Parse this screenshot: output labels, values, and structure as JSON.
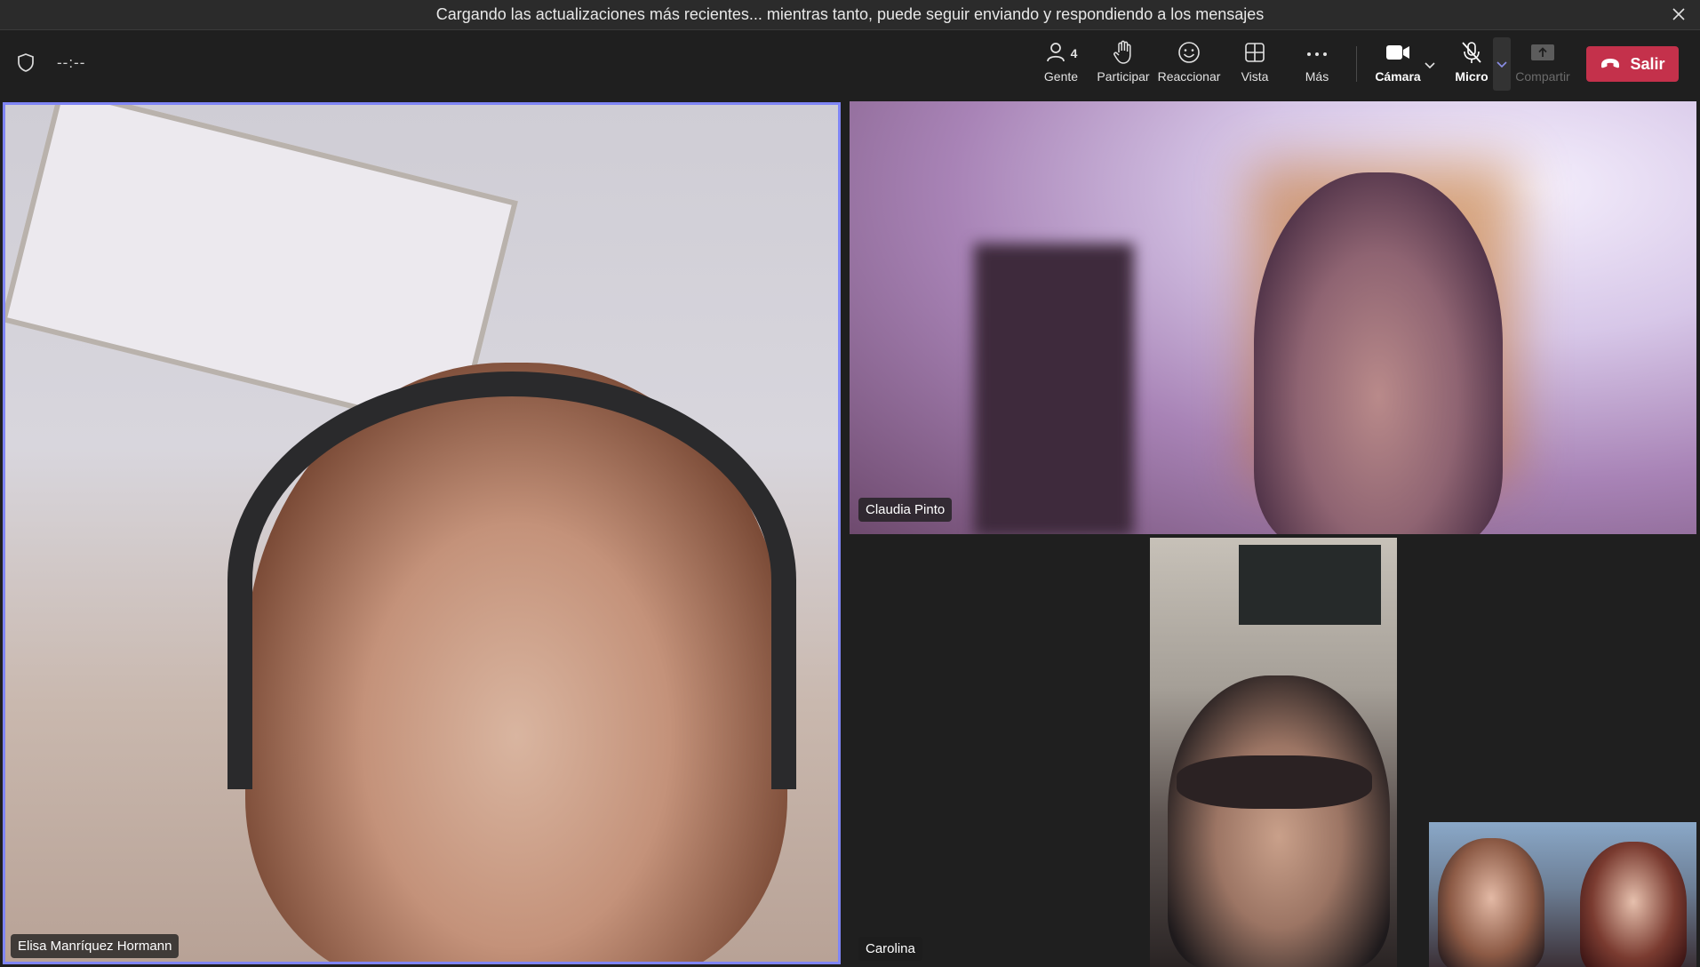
{
  "banner": {
    "message": "Cargando las actualizaciones más recientes... mientras tanto, puede seguir enviando y respondiendo a los mensajes",
    "close_icon": "close-icon"
  },
  "toolbar": {
    "timer": "--:--",
    "people": {
      "label": "Gente",
      "count": "4",
      "icon": "people-icon"
    },
    "raise_hand": {
      "label": "Participar",
      "icon": "hand-icon"
    },
    "react": {
      "label": "Reaccionar",
      "icon": "smiley-icon"
    },
    "view": {
      "label": "Vista",
      "icon": "grid-icon"
    },
    "more": {
      "label": "Más",
      "icon": "ellipsis-icon"
    },
    "camera": {
      "label": "Cámara",
      "icon": "video-camera-icon"
    },
    "mic": {
      "label": "Micro",
      "icon": "mic-muted-icon"
    },
    "share": {
      "label": "Compartir",
      "icon": "share-tray-icon"
    },
    "leave": {
      "label": "Salir",
      "icon": "phone-hangup-icon"
    }
  },
  "participants": [
    {
      "name": "Elisa Manríquez Hormann",
      "active_speaker": true
    },
    {
      "name": "Claudia Pinto"
    },
    {
      "name": "Carolina"
    }
  ],
  "colors": {
    "accent": "#7f85f5",
    "leave": "#c4314b",
    "background": "#1f1f1f"
  }
}
